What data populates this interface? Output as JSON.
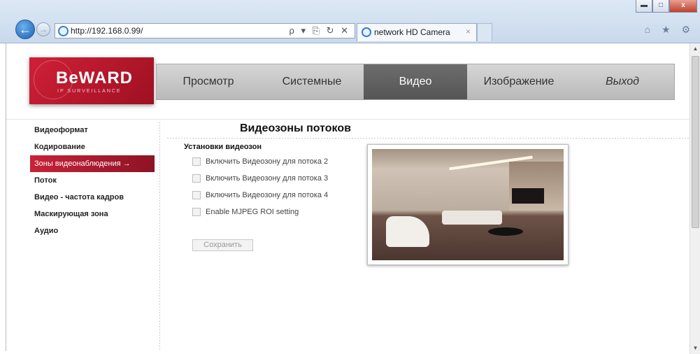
{
  "browser": {
    "url": "http://192.168.0.99/",
    "address_tools": "ρ ▾ ⎘ ↻ ✕",
    "tab_title": "network HD Camera",
    "tab_close": "×",
    "window_controls": {
      "minimize": "▬",
      "maximize": "□",
      "close": "x"
    },
    "toolbar_icons": "⌂ ★ ⚙",
    "back_glyph": "←",
    "forward_glyph": "→"
  },
  "brand": {
    "name": "BeWARD",
    "tagline": "IP SURVEILLANCE"
  },
  "menu": [
    {
      "label": "Просмотр",
      "active": false
    },
    {
      "label": "Системные",
      "active": false
    },
    {
      "label": "Видео",
      "active": true
    },
    {
      "label": "Изображение",
      "active": false
    },
    {
      "label": "Выход",
      "active": false
    }
  ],
  "sidebar": [
    {
      "label": "Видеоформат",
      "active": false
    },
    {
      "label": "Кодирование",
      "active": false
    },
    {
      "label": "Зоны видеонаблюдения →",
      "active": true
    },
    {
      "label": "Поток",
      "active": false
    },
    {
      "label": "Видео - частота кадров",
      "active": false
    },
    {
      "label": "Маскирующая зона",
      "active": false
    },
    {
      "label": "Аудио",
      "active": false
    }
  ],
  "content": {
    "title": "Видеозоны потоков",
    "section_title": "Установки видеозон",
    "checkboxes": [
      {
        "label": "Включить Видеозону для потока 2",
        "checked": false
      },
      {
        "label": "Включить Видеозону для потока 3",
        "checked": false
      },
      {
        "label": "Включить Видеозону для потока 4",
        "checked": false
      },
      {
        "label": "Enable MJPEG ROI setting",
        "checked": false
      }
    ],
    "save_label": "Сохранить"
  },
  "scrollbar": {
    "up": "▲",
    "down": "▼"
  },
  "colors": {
    "brand_red": "#c72238",
    "menu_active": "#5f5f5f",
    "menu_bg": "#c8c8c8"
  }
}
